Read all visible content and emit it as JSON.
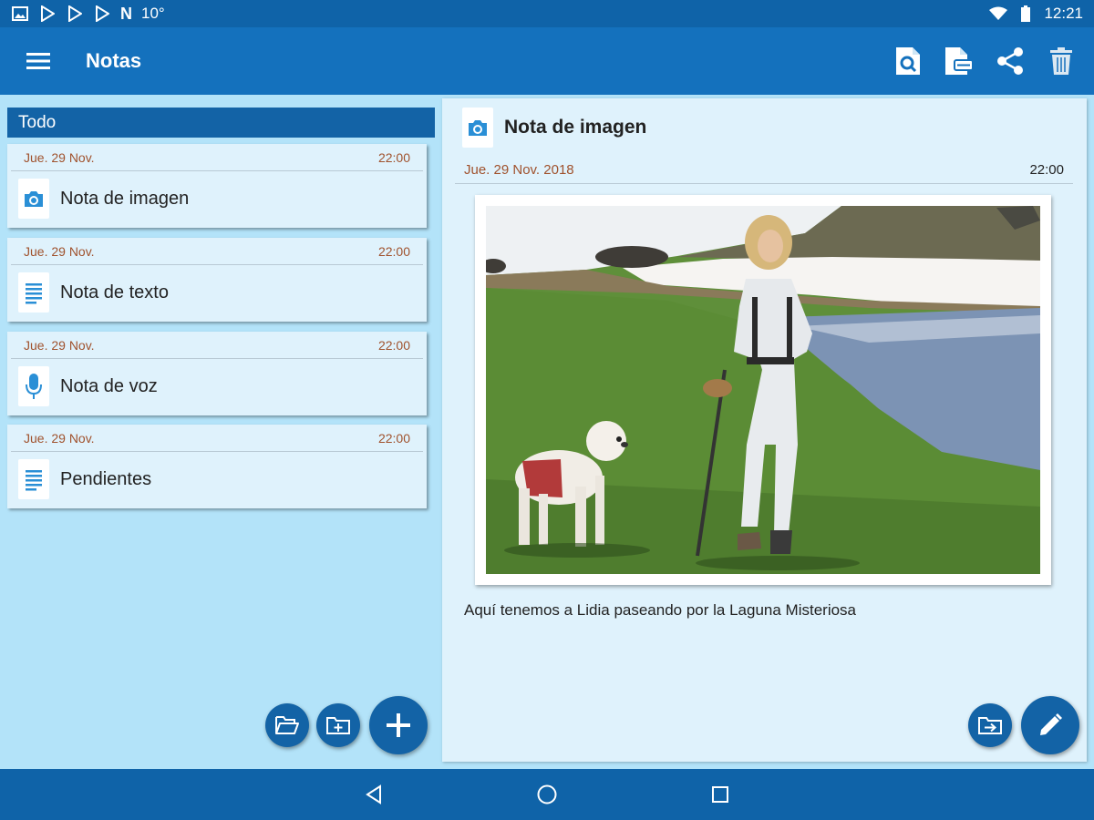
{
  "status_bar": {
    "clock": "12:21",
    "notif_number": "10°",
    "notif_letter": "N"
  },
  "app_bar": {
    "title": "Notas",
    "actions": [
      "search-note-icon",
      "note-tag-icon",
      "share-icon",
      "trash-icon"
    ]
  },
  "folder": {
    "name": "Todo"
  },
  "notes": [
    {
      "date": "Jue. 29 Nov.",
      "time": "22:00",
      "title": "Nota de imagen",
      "type": "camera"
    },
    {
      "date": "Jue. 29 Nov.",
      "time": "22:00",
      "title": "Nota de texto",
      "type": "text"
    },
    {
      "date": "Jue. 29 Nov.",
      "time": "22:00",
      "title": "Nota de voz",
      "type": "voice"
    },
    {
      "date": "Jue. 29 Nov.",
      "time": "22:00",
      "title": "Pendientes",
      "type": "text"
    }
  ],
  "detail": {
    "title": "Nota de imagen",
    "date": "Jue. 29 Nov. 2018",
    "time": "22:00",
    "caption": "Aquí tenemos a Lidia paseando por la Laguna Misteriosa"
  },
  "colors": {
    "primary": "#1471bd",
    "dark": "#0f63a8",
    "panel": "#dff2fc",
    "background": "#b3e3f9",
    "date_text": "#a0522d"
  }
}
